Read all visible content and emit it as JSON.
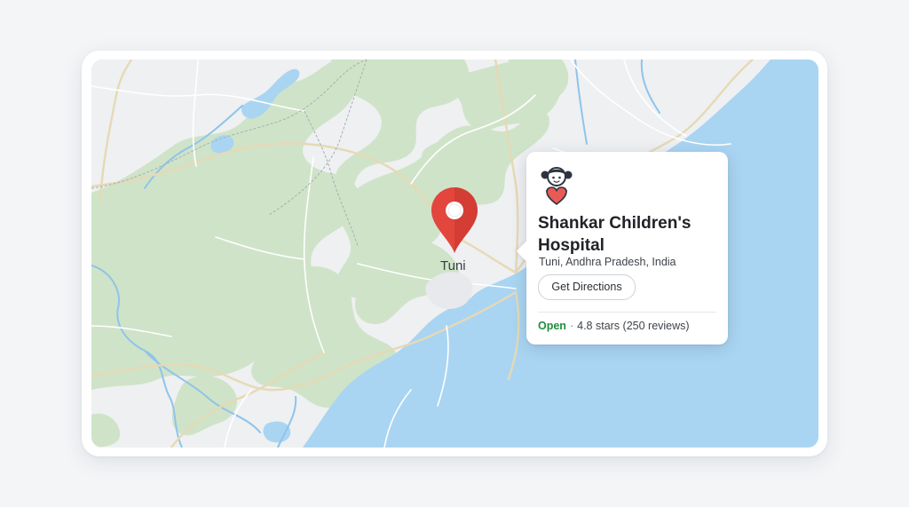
{
  "map": {
    "city_label": "Tuni",
    "colors": {
      "land": "#eef0f2",
      "forest": "#cfe3c8",
      "water": "#a9d5f2",
      "river": "#8fc4ea",
      "road": "#e6d9b4",
      "minor_road": "#ffffff"
    }
  },
  "pin": {
    "icon": "location-pin-icon",
    "color": "#e2463c"
  },
  "place_card": {
    "icon": "child-heart-icon",
    "title": "Shankar Children's Hospital",
    "address": "Tuni, Andhra Pradesh, India",
    "directions_label": "Get Directions",
    "status": "Open",
    "status_color": "#1e8e3e",
    "separator": "·",
    "rating": "4.8 stars (250 reviews)"
  }
}
